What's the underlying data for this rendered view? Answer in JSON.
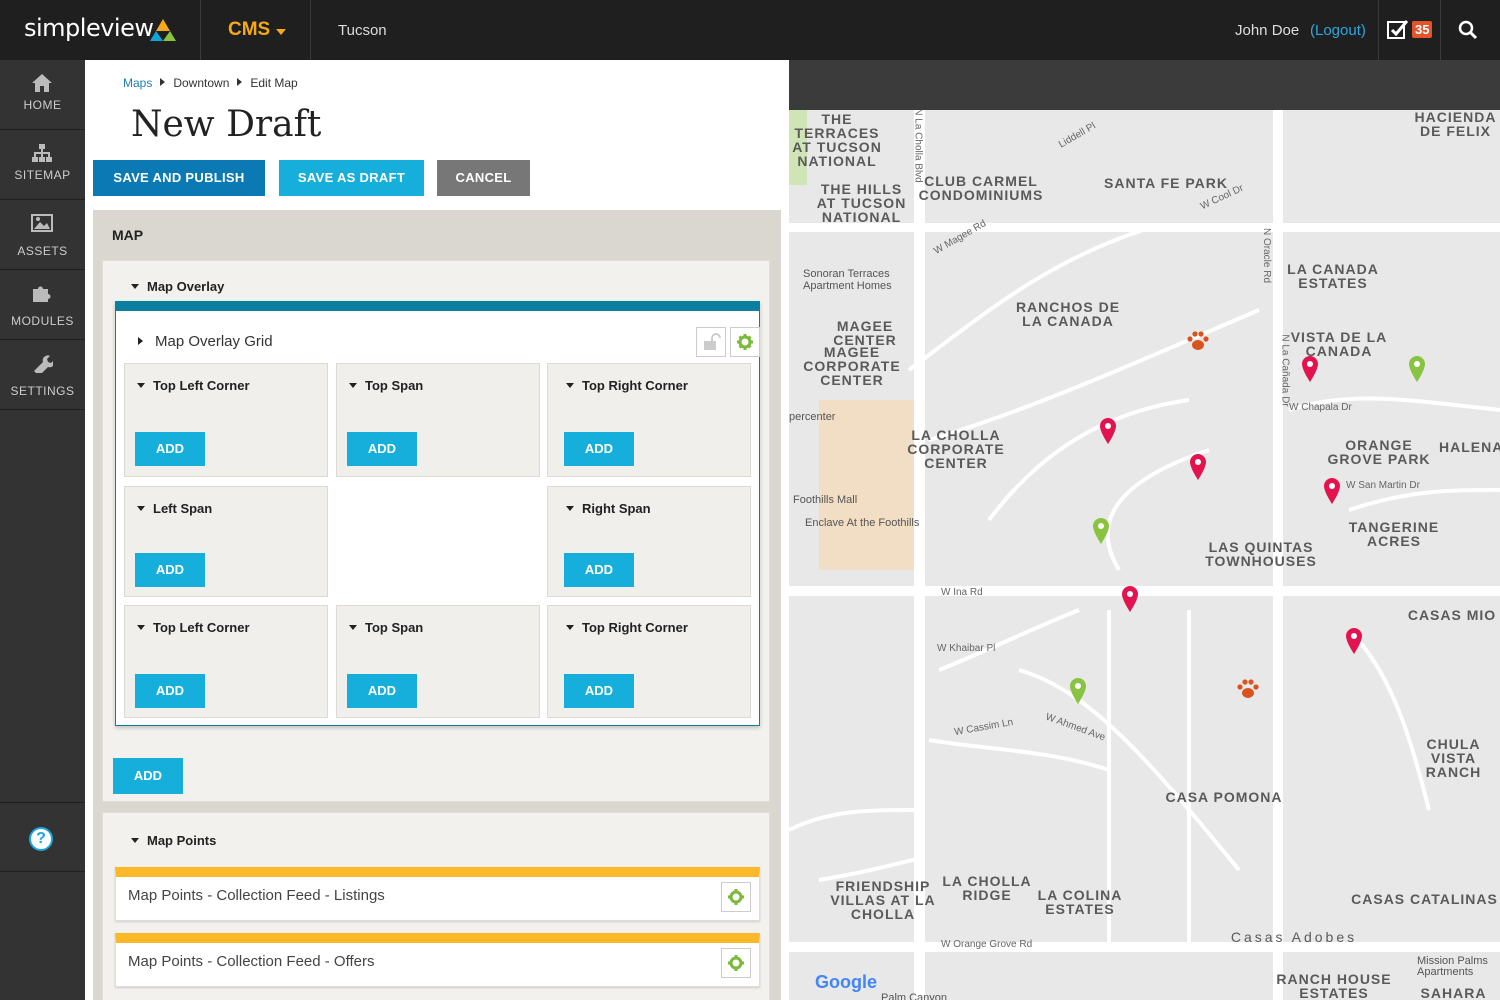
{
  "topbar": {
    "logo": "simpleview",
    "app": "CMS",
    "site": "Tucson",
    "user": "John Doe",
    "logout": "(Logout)",
    "task_count": "35"
  },
  "sidebar": {
    "items": [
      {
        "label": "HOME",
        "icon": "home-icon"
      },
      {
        "label": "SITEMAP",
        "icon": "sitemap-icon"
      },
      {
        "label": "ASSETS",
        "icon": "image-icon"
      },
      {
        "label": "MODULES",
        "icon": "puzzle-icon"
      },
      {
        "label": "SETTINGS",
        "icon": "wrench-icon"
      }
    ],
    "help": "?"
  },
  "breadcrumb": [
    "Maps",
    "Downtown",
    "Edit Map"
  ],
  "page_title": "New Draft",
  "actions": {
    "publish": "SAVE AND PUBLISH",
    "draft": "SAVE AS DRAFT",
    "cancel": "CANCEL"
  },
  "map_section": {
    "heading": "MAP",
    "overlay": {
      "title": "Map Overlay",
      "grid_title": "Map Overlay Grid",
      "cells": [
        {
          "title": "Top Left Corner",
          "button": "ADD"
        },
        {
          "title": "Top Span",
          "button": "ADD"
        },
        {
          "title": "Top Right Corner",
          "button": "ADD"
        },
        {
          "title": "Left Span",
          "button": "ADD"
        },
        {
          "title": "Right Span",
          "button": "ADD"
        },
        {
          "title": "Top Left Corner",
          "button": "ADD"
        },
        {
          "title": "Top Span",
          "button": "ADD"
        },
        {
          "title": "Top Right Corner",
          "button": "ADD"
        }
      ],
      "add_button": "ADD"
    },
    "points": {
      "title": "Map Points",
      "feeds": [
        "Map Points - Collection Feed - Listings",
        "Map Points - Collection Feed - Offers"
      ]
    }
  },
  "map": {
    "area_labels": [
      "THE TERRACES AT TUCSON NATIONAL",
      "THE HILLS AT TUCSON NATIONAL",
      "CLUB CARMEL CONDOMINIUMS",
      "SANTA FE PARK",
      "HACIENDA DE FELIX",
      "RANCHOS DE LA CANADA",
      "LA CANADA ESTATES",
      "MAGEE CENTER",
      "MAGEE CORPORATE CENTER",
      "VISTA DE LA CANADA",
      "LA CHOLLA CORPORATE CENTER",
      "ORANGE GROVE PARK",
      "HALENA",
      "TANGERINE ACRES",
      "LAS QUINTAS TOWNHOUSES",
      "CASAS MIO",
      "CHULA VISTA RANCH",
      "CASA POMONA",
      "FRIENDSHIP VILLAS AT LA CHOLLA",
      "LA CHOLLA RIDGE",
      "LA COLINA ESTATES",
      "CASAS CATALINAS",
      "Casas Adobes",
      "RANCH HOUSE ESTATES",
      "SAHARA PALA"
    ],
    "street_labels": [
      "W Magee Rd",
      "W Ina Rd",
      "W Orange Grove Rd",
      "N La Cholla Blvd",
      "N La Cañada Dr",
      "W Chapala Dr",
      "W San Martin Dr",
      "W Khaibar Pl",
      "W Cassim Ln",
      "W Ahmed Ave",
      "N Oracle Rd",
      "W Cool Dr",
      "Liddell Pl"
    ],
    "pois": [
      "Sonoran Terraces Apartment Homes",
      "Foothills Mall",
      "Enclave At the Foothills",
      "percenter",
      "Mission Palms Apartments",
      "Palm Canyon"
    ],
    "brand": "Google",
    "pin_colors": {
      "listing": "#e2144f",
      "offer": "#88c442",
      "pet": "#d9531e"
    }
  }
}
